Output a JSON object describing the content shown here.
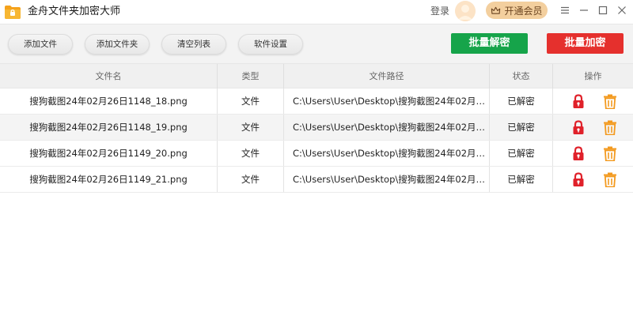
{
  "app": {
    "title": "金舟文件夹加密大师",
    "login_label": "登录",
    "vip_label": "开通会员"
  },
  "toolbar": {
    "add_file_label": "添加文件",
    "add_folder_label": "添加文件夹",
    "clear_list_label": "清空列表",
    "settings_label": "软件设置",
    "batch_decrypt_label": "批量解密",
    "batch_encrypt_label": "批量加密"
  },
  "colors": {
    "decrypt_green": "#16a44a",
    "encrypt_red": "#e5302d",
    "lock_red": "#e0212a",
    "trash_orange": "#f39a1f",
    "logo_orange": "#f5a21b"
  },
  "table": {
    "headers": {
      "name": "文件名",
      "type": "类型",
      "path": "文件路径",
      "status": "状态",
      "action": "操作"
    },
    "rows": [
      {
        "name": "搜狗截图24年02月26日1148_18.png",
        "type": "文件",
        "path": "C:\\Users\\User\\Desktop\\搜狗截图24年02月26...",
        "status": "已解密"
      },
      {
        "name": "搜狗截图24年02月26日1148_19.png",
        "type": "文件",
        "path": "C:\\Users\\User\\Desktop\\搜狗截图24年02月26...",
        "status": "已解密"
      },
      {
        "name": "搜狗截图24年02月26日1149_20.png",
        "type": "文件",
        "path": "C:\\Users\\User\\Desktop\\搜狗截图24年02月26...",
        "status": "已解密"
      },
      {
        "name": "搜狗截图24年02月26日1149_21.png",
        "type": "文件",
        "path": "C:\\Users\\User\\Desktop\\搜狗截图24年02月26...",
        "status": "已解密"
      }
    ]
  },
  "icons": {
    "logo": "folder-lock-logo-icon",
    "vip": "crown-icon",
    "menu": "menu-icon",
    "minimize": "minimize-icon",
    "maximize": "maximize-icon",
    "close": "close-icon",
    "row_lock": "lock-icon",
    "row_delete": "trash-icon"
  }
}
